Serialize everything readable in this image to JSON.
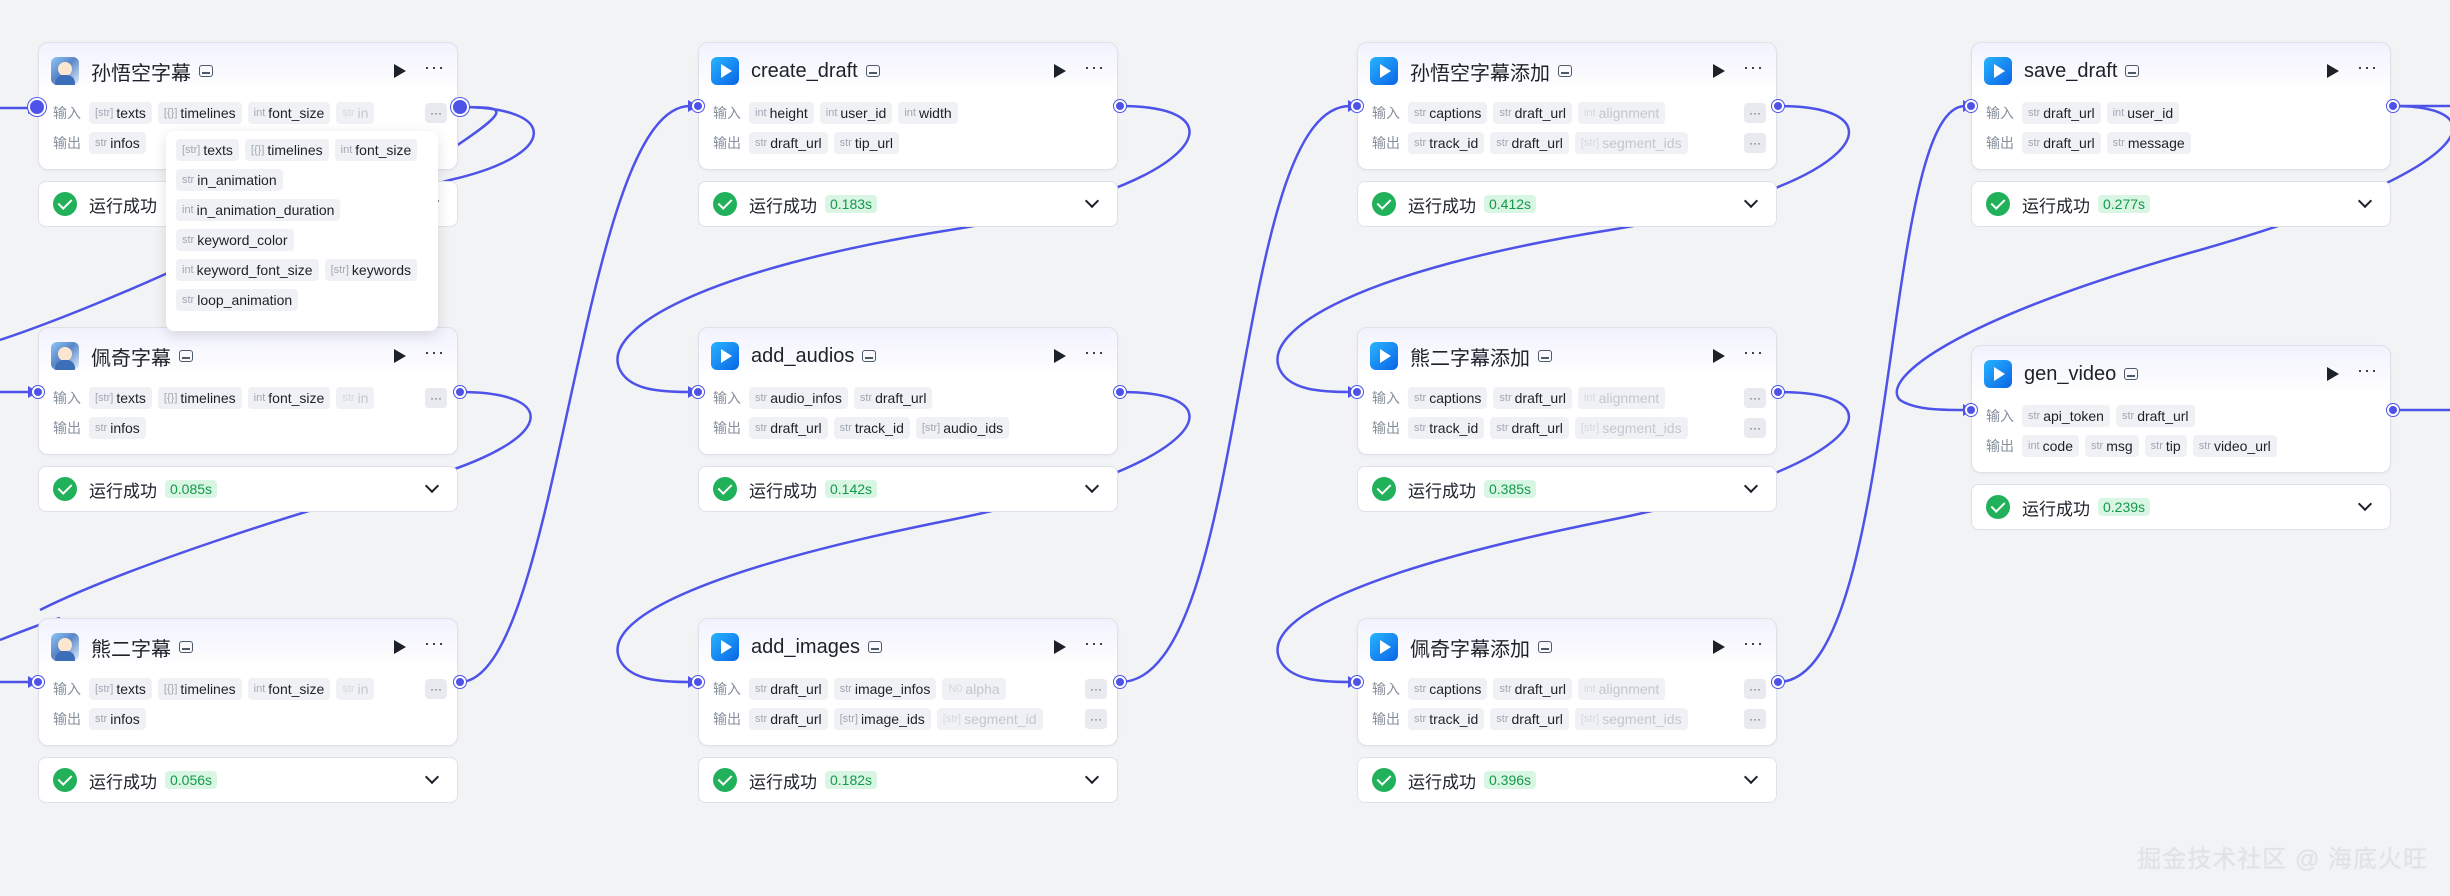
{
  "labels": {
    "input": "输入",
    "output": "输出",
    "run_success": "运行成功"
  },
  "nodes": [
    {
      "title": "孙悟空字幕",
      "inputs": [
        {
          "t": "[str]",
          "n": "texts"
        },
        {
          "t": "[{}]",
          "n": "timelines"
        },
        {
          "t": "int",
          "n": "font_size"
        },
        {
          "t": "str",
          "n": "in"
        }
      ],
      "outputs": [
        {
          "t": "str",
          "n": "infos"
        }
      ],
      "time": ""
    },
    {
      "title": "佩奇字幕",
      "inputs": [
        {
          "t": "[str]",
          "n": "texts"
        },
        {
          "t": "[{}]",
          "n": "timelines"
        },
        {
          "t": "int",
          "n": "font_size"
        },
        {
          "t": "str",
          "n": "in"
        }
      ],
      "outputs": [
        {
          "t": "str",
          "n": "infos"
        }
      ],
      "time": "0.085s"
    },
    {
      "title": "熊二字幕",
      "inputs": [
        {
          "t": "[str]",
          "n": "texts"
        },
        {
          "t": "[{}]",
          "n": "timelines"
        },
        {
          "t": "int",
          "n": "font_size"
        },
        {
          "t": "str",
          "n": "in"
        }
      ],
      "outputs": [
        {
          "t": "str",
          "n": "infos"
        }
      ],
      "time": "0.056s"
    },
    {
      "title": "create_draft",
      "inputs": [
        {
          "t": "int",
          "n": "height"
        },
        {
          "t": "int",
          "n": "user_id"
        },
        {
          "t": "int",
          "n": "width"
        }
      ],
      "outputs": [
        {
          "t": "str",
          "n": "draft_url"
        },
        {
          "t": "str",
          "n": "tip_url"
        }
      ],
      "time": "0.183s"
    },
    {
      "title": "add_audios",
      "inputs": [
        {
          "t": "str",
          "n": "audio_infos"
        },
        {
          "t": "str",
          "n": "draft_url"
        }
      ],
      "outputs": [
        {
          "t": "str",
          "n": "draft_url"
        },
        {
          "t": "str",
          "n": "track_id"
        },
        {
          "t": "[str]",
          "n": "audio_ids"
        }
      ],
      "time": "0.142s"
    },
    {
      "title": "add_images",
      "inputs": [
        {
          "t": "str",
          "n": "draft_url"
        },
        {
          "t": "str",
          "n": "image_infos"
        },
        {
          "t": "N0",
          "n": "alpha"
        }
      ],
      "outputs": [
        {
          "t": "str",
          "n": "draft_url"
        },
        {
          "t": "[str]",
          "n": "image_ids"
        },
        {
          "t": "[str]",
          "n": "segment_id"
        }
      ],
      "time": "0.182s"
    },
    {
      "title": "孙悟空字幕添加",
      "inputs": [
        {
          "t": "str",
          "n": "captions"
        },
        {
          "t": "str",
          "n": "draft_url"
        },
        {
          "t": "int",
          "n": "alignment"
        }
      ],
      "outputs": [
        {
          "t": "str",
          "n": "track_id"
        },
        {
          "t": "str",
          "n": "draft_url"
        },
        {
          "t": "[str]",
          "n": "segment_ids"
        }
      ],
      "time": "0.412s"
    },
    {
      "title": "熊二字幕添加",
      "inputs": [
        {
          "t": "str",
          "n": "captions"
        },
        {
          "t": "str",
          "n": "draft_url"
        },
        {
          "t": "int",
          "n": "alignment"
        }
      ],
      "outputs": [
        {
          "t": "str",
          "n": "track_id"
        },
        {
          "t": "str",
          "n": "draft_url"
        },
        {
          "t": "[str]",
          "n": "segment_ids"
        }
      ],
      "time": "0.385s"
    },
    {
      "title": "佩奇字幕添加",
      "inputs": [
        {
          "t": "str",
          "n": "captions"
        },
        {
          "t": "str",
          "n": "draft_url"
        },
        {
          "t": "int",
          "n": "alignment"
        }
      ],
      "outputs": [
        {
          "t": "str",
          "n": "track_id"
        },
        {
          "t": "str",
          "n": "draft_url"
        },
        {
          "t": "[str]",
          "n": "segment_ids"
        }
      ],
      "time": "0.396s"
    },
    {
      "title": "save_draft",
      "inputs": [
        {
          "t": "str",
          "n": "draft_url"
        },
        {
          "t": "int",
          "n": "user_id"
        }
      ],
      "outputs": [
        {
          "t": "str",
          "n": "draft_url"
        },
        {
          "t": "str",
          "n": "message"
        }
      ],
      "time": "0.277s"
    },
    {
      "title": "gen_video",
      "inputs": [
        {
          "t": "str",
          "n": "api_token"
        },
        {
          "t": "str",
          "n": "draft_url"
        }
      ],
      "outputs": [
        {
          "t": "int",
          "n": "code"
        },
        {
          "t": "str",
          "n": "msg"
        },
        {
          "t": "str",
          "n": "tip"
        },
        {
          "t": "str",
          "n": "video_url"
        }
      ],
      "time": "0.239s"
    }
  ],
  "dropdown": [
    [
      {
        "t": "[str]",
        "n": "texts"
      },
      {
        "t": "[{}]",
        "n": "timelines"
      },
      {
        "t": "int",
        "n": "font_size"
      }
    ],
    [
      {
        "t": "str",
        "n": "in_animation"
      }
    ],
    [
      {
        "t": "int",
        "n": "in_animation_duration"
      }
    ],
    [
      {
        "t": "str",
        "n": "keyword_color"
      }
    ],
    [
      {
        "t": "int",
        "n": "keyword_font_size"
      },
      {
        "t": "[str]",
        "n": "keywords"
      }
    ],
    [
      {
        "t": "str",
        "n": "loop_animation"
      }
    ]
  ],
  "watermark": "掘金技术社区 @ 海底火旺",
  "colors": {
    "edge": "#4d53e8",
    "success": "#20b15a",
    "canvas": "#f2f3f5"
  }
}
